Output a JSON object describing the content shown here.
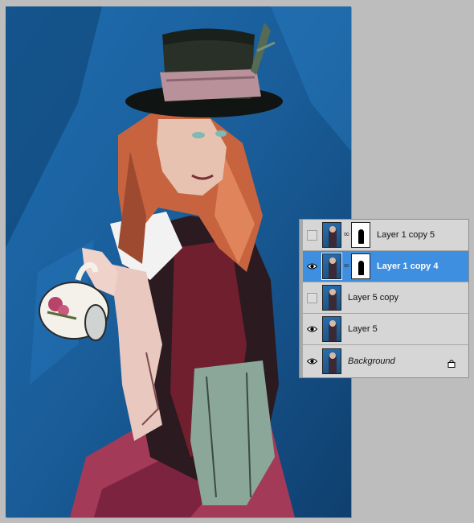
{
  "layers": [
    {
      "name": "Layer 1 copy 5",
      "visible": false,
      "selected": false,
      "has_mask": true,
      "italic": false
    },
    {
      "name": "Layer 1 copy 4",
      "visible": true,
      "selected": true,
      "has_mask": true,
      "italic": false
    },
    {
      "name": "Layer 5 copy",
      "visible": false,
      "selected": false,
      "has_mask": false,
      "italic": false
    },
    {
      "name": "Layer 5",
      "visible": true,
      "selected": false,
      "has_mask": false,
      "italic": false
    },
    {
      "name": "Background",
      "visible": true,
      "selected": false,
      "has_mask": false,
      "italic": true,
      "locked": true
    }
  ],
  "colors": {
    "canvas_bg": "#1a5e98",
    "panel_bg": "#d6d6d6",
    "selection": "#3f8fe0",
    "workspace": "#bdbdbd"
  },
  "icons": {
    "visibility": "eye-icon",
    "link": "chain-link-icon",
    "lock": "lock-icon"
  }
}
